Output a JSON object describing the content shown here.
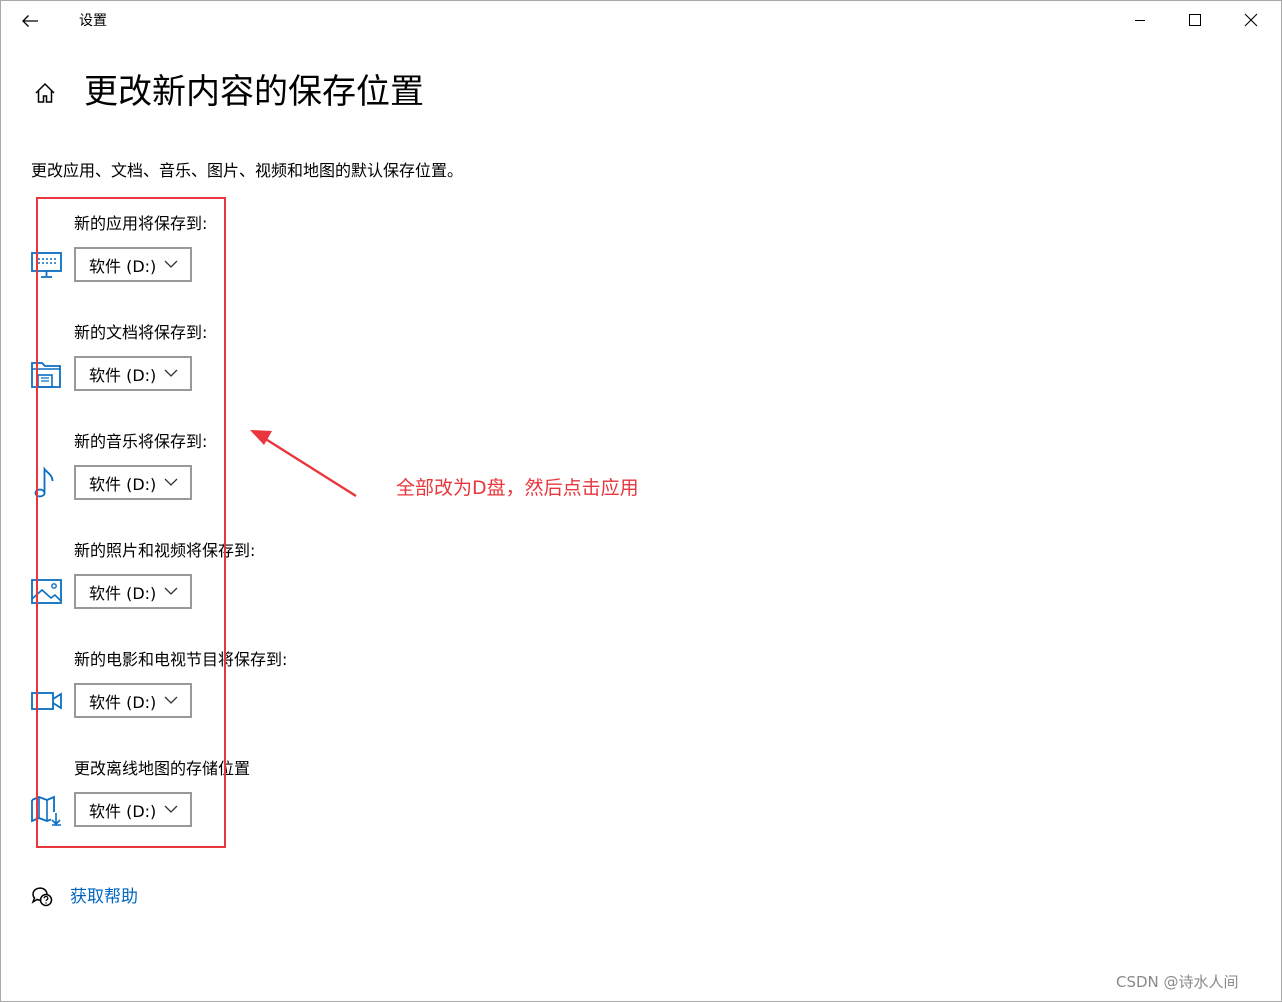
{
  "window": {
    "title": "设置",
    "controls": {
      "minimize": "minimize-icon",
      "maximize": "maximize-icon",
      "close": "close-icon"
    }
  },
  "page": {
    "title": "更改新内容的保存位置",
    "description": "更改应用、文档、音乐、图片、视频和地图的默认保存位置。"
  },
  "settings": [
    {
      "label": "新的应用将保存到:",
      "icon": "monitor-icon",
      "value": "软件 (D:)"
    },
    {
      "label": "新的文档将保存到:",
      "icon": "documents-folder-icon",
      "value": "软件 (D:)"
    },
    {
      "label": "新的音乐将保存到:",
      "icon": "music-note-icon",
      "value": "软件 (D:)"
    },
    {
      "label": "新的照片和视频将保存到:",
      "icon": "picture-icon",
      "value": "软件 (D:)"
    },
    {
      "label": "新的电影和电视节目将保存到:",
      "icon": "video-camera-icon",
      "value": "软件 (D:)"
    },
    {
      "label": "更改离线地图的存储位置",
      "icon": "map-download-icon",
      "value": "软件 (D:)"
    }
  ],
  "annotation": {
    "text": "全部改为D盘，然后点击应用",
    "color": "#e8363c"
  },
  "help": {
    "label": "获取帮助"
  },
  "watermark": "CSDN @诗水人间",
  "colors": {
    "accent": "#0067c0",
    "icon_blue": "#0a6fc2",
    "annotation_red": "#e8363c",
    "border_gray": "#999999"
  }
}
